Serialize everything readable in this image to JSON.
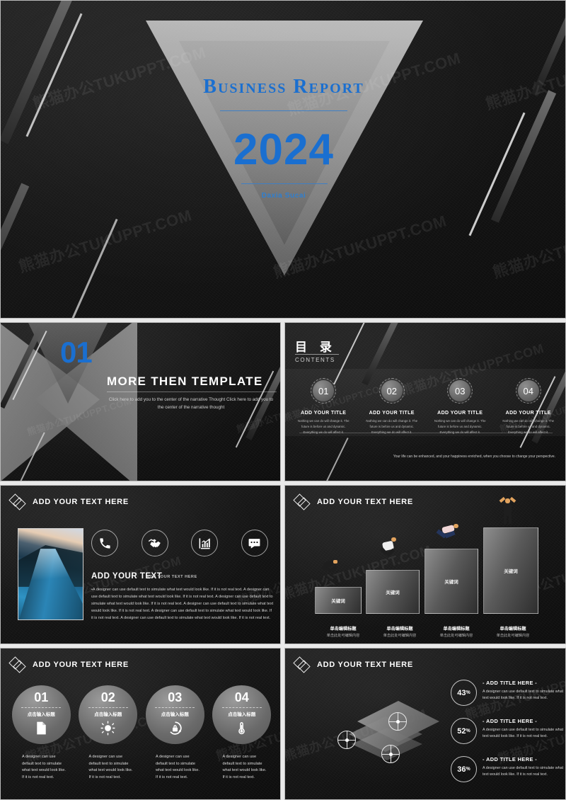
{
  "watermark": {
    "text": "熊猫办公TUKUPPT.COM"
  },
  "colors": {
    "accent_blue": "#1a6fd0",
    "slide_bg": "#141414",
    "panel_gray": "#6a6a6a"
  },
  "slide_cover": {
    "title": "Business  Report",
    "year": "2024",
    "subtitle": "Daxia Sucai"
  },
  "slide_section": {
    "number": "01",
    "title": "MORE  THEN  TEMPLATE",
    "body": "Click here to add  you to the  center of the  narrative Thought  Click here to add   you to the  center of the narrative thought"
  },
  "slide_contents": {
    "title_cn": "目 录",
    "title_en": "CONTENTS",
    "items": [
      {
        "number": "01",
        "title": "ADD YOUR TITLE",
        "desc": "Nothing we can do will change it. The future is before us and dynamic. Everything we do will affect it."
      },
      {
        "number": "02",
        "title": "ADD YOUR TITLE",
        "desc": "Nothing we can do will change it. The future is before us and dynamic. Everything we do will affect it."
      },
      {
        "number": "03",
        "title": "ADD YOUR TITLE",
        "desc": "Nothing we can do will change it. The future is before us and dynamic. Everything we do will affect it."
      },
      {
        "number": "04",
        "title": "ADD YOUR TITLE",
        "desc": "Nothing we can do will change it. The future is before us and dynamic. Everything we do will affect it."
      }
    ],
    "footer": "Your life can be enhanced, and your happiness enriched, when you choose to change your perspective."
  },
  "slide_photo": {
    "header": "ADD YOUR TEXT HERE",
    "icons": [
      "phone-icon",
      "handshake-icon",
      "bar-chart-icon",
      "chat-icon"
    ],
    "sub_title": "ADD YOUR TEXT",
    "sub_label": "ADD YOUR TEXT HERE",
    "paragraph": "•A designer can use default text to simulate what text would look like. If it is not real text. A designer can use default text to simulate what text would look like. If it is not real text. A designer can use default text to simulate what text would look like. If it is not real text. A designer can use default text to simulate what text would look like. If it is not real text. A designer can use default text to simulate what text would look like. If it is not real text. A designer can use default text to simulate what text would look like. If it is not real text."
  },
  "slide_stairs": {
    "header": "ADD YOUR TEXT HERE",
    "bars": [
      {
        "keyword": "关键词",
        "title": "单击编辑标题",
        "desc": "单击此处可编辑内容",
        "height_pct": 36
      },
      {
        "keyword": "关键词",
        "title": "单击编辑标题",
        "desc": "单击此处可编辑内容",
        "height_pct": 56
      },
      {
        "keyword": "关键词",
        "title": "单击编辑标题",
        "desc": "单击此处可编辑内容",
        "height_pct": 78
      },
      {
        "keyword": "关键词",
        "title": "单击编辑标题",
        "desc": "单击此处可编辑内容",
        "height_pct": 100
      }
    ]
  },
  "slide_circles": {
    "header": "ADD YOUR TEXT HERE",
    "items": [
      {
        "number": "01",
        "zh": "点击输入标题",
        "icon": "document-icon",
        "desc": "A designer can use default text to simulate what text would look like. If it is not real text."
      },
      {
        "number": "02",
        "zh": "点击输入标题",
        "icon": "sun-icon",
        "desc": "A designer can use default text to simulate what text would look like. If it is not real text."
      },
      {
        "number": "03",
        "zh": "点击输入标题",
        "icon": "lock-refresh-icon",
        "desc": "A designer can use default text to simulate what text would look like. If it is not real text."
      },
      {
        "number": "04",
        "zh": "点击输入标题",
        "icon": "thermometer-icon",
        "desc": "A designer can use default text to simulate what text would look like. If it is not real text."
      }
    ]
  },
  "slide_layers": {
    "header": "ADD YOUR TEXT HERE",
    "items": [
      {
        "percent": "43",
        "unit": "%",
        "title": "- ADD TITLE HERE -",
        "desc": "A designer can use default text to simulate what text would look like. If it is not real text."
      },
      {
        "percent": "52",
        "unit": "%",
        "title": "- ADD TITLE HERE -",
        "desc": "A designer can use default text to simulate what text would look like. If it is not real text."
      },
      {
        "percent": "36",
        "unit": "%",
        "title": "- ADD TITLE HERE -",
        "desc": "A designer can use default text to simulate what text would look like. If it is not real text."
      }
    ]
  }
}
